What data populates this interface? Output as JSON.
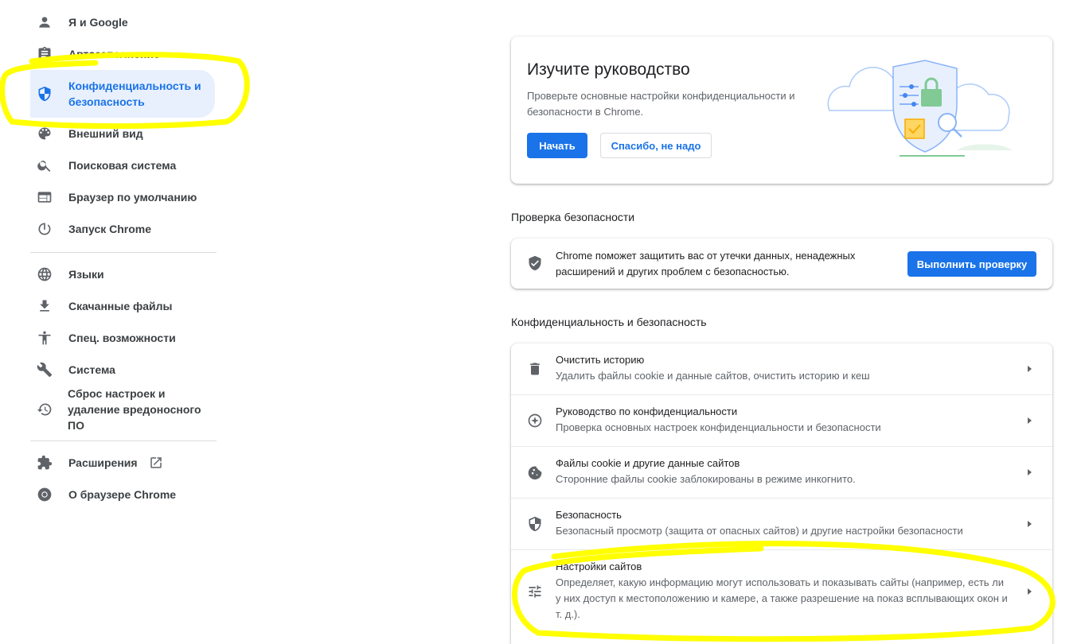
{
  "sidebar": {
    "items": [
      {
        "label": "Я и Google",
        "icon": "person-icon"
      },
      {
        "label": "Автозаполнение",
        "icon": "clipboard-icon"
      },
      {
        "label": "Конфиденциальность и безопасность",
        "icon": "shield-icon",
        "active": true
      },
      {
        "label": "Внешний вид",
        "icon": "palette-icon"
      },
      {
        "label": "Поисковая система",
        "icon": "search-icon"
      },
      {
        "label": "Браузер по умолчанию",
        "icon": "browser-icon"
      },
      {
        "label": "Запуск Chrome",
        "icon": "power-icon"
      },
      {
        "label": "Языки",
        "icon": "globe-icon"
      },
      {
        "label": "Скачанные файлы",
        "icon": "download-icon"
      },
      {
        "label": "Спец. возможности",
        "icon": "accessibility-icon"
      },
      {
        "label": "Система",
        "icon": "wrench-icon"
      },
      {
        "label": "Сброс настроек и удаление вредоносного ПО",
        "icon": "restore-icon"
      },
      {
        "label": "Расширения",
        "icon": "puzzle-icon"
      },
      {
        "label": "О браузере Chrome",
        "icon": "chrome-icon"
      }
    ],
    "extensions_external_icon": "open-in-new-icon"
  },
  "promo": {
    "title": "Изучите руководство",
    "description": "Проверьте основные настройки конфиденциальности и безопасности в Chrome.",
    "start_button": "Начать",
    "dismiss_button": "Спасибо, не надо"
  },
  "safety_check": {
    "heading": "Проверка безопасности",
    "text": "Chrome поможет защитить вас от утечки данных, ненадежных расширений и других проблем с безопасностью.",
    "button": "Выполнить проверку"
  },
  "privacy": {
    "heading": "Конфиденциальность и безопасность",
    "rows": [
      {
        "title": "Очистить историю",
        "subtitle": "Удалить файлы cookie и данные сайтов, очистить историю и кеш",
        "icon": "trash-icon"
      },
      {
        "title": "Руководство по конфиденциальности",
        "subtitle": "Проверка основных настроек конфиденциальности и безопасности",
        "icon": "compass-icon"
      },
      {
        "title": "Файлы cookie и другие данные сайтов",
        "subtitle": "Сторонние файлы cookie заблокированы в режиме инкогнито.",
        "icon": "cookie-icon"
      },
      {
        "title": "Безопасность",
        "subtitle": "Безопасный просмотр (защита от опасных сайтов) и другие настройки безопасности",
        "icon": "shield-half-icon"
      },
      {
        "title": "Настройки сайтов",
        "subtitle": "Определяет, какую информацию могут использовать и показывать сайты (например, есть ли у них доступ к местоположению и камере, а также разрешение на показ всплывающих окон и т. д.).",
        "icon": "tune-icon"
      }
    ]
  },
  "colors": {
    "accent": "#1a73e8",
    "active_bg": "#e8f0fe",
    "highlighter": "#ffff00"
  }
}
